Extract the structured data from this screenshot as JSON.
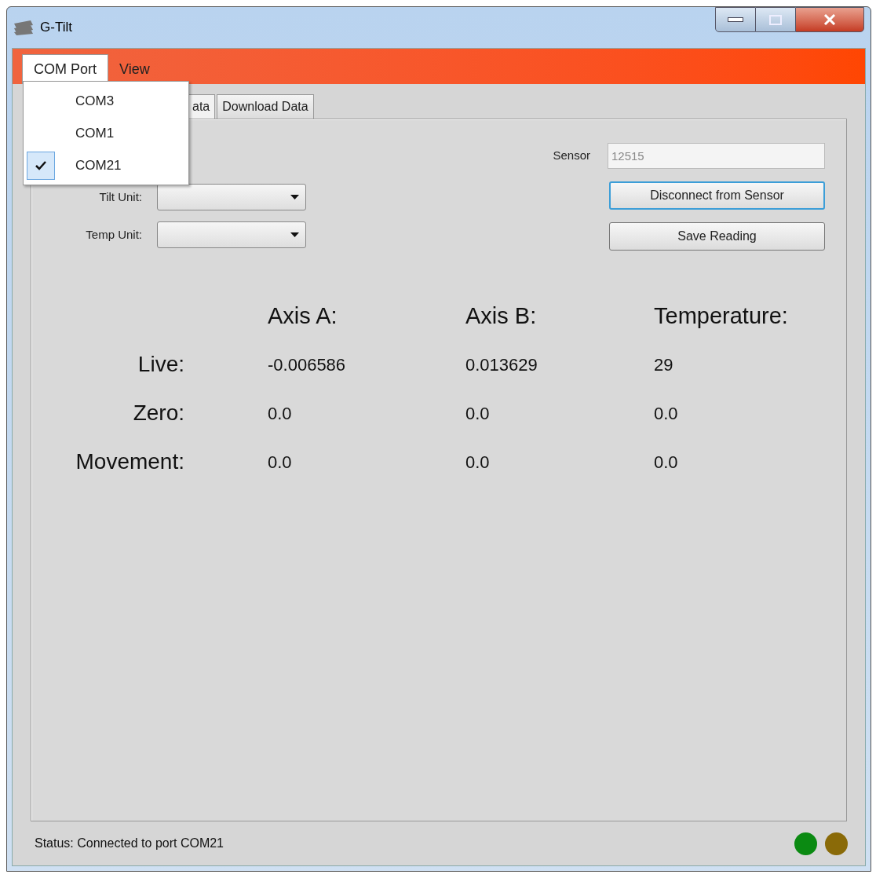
{
  "window": {
    "title": "G-Tilt"
  },
  "menu_bar": [
    {
      "label": "COM Port",
      "selected": true
    },
    {
      "label": "View",
      "selected": false
    }
  ],
  "com_port_menu": [
    {
      "label": "COM3",
      "checked": false
    },
    {
      "label": "COM1",
      "checked": false
    },
    {
      "label": "COM21",
      "checked": true
    }
  ],
  "tabs": [
    {
      "label": "ata",
      "selected": true
    },
    {
      "label": "Download Data",
      "selected": false
    }
  ],
  "settings": [
    {
      "label": "Tilt Unit:"
    },
    {
      "label": "Temp Unit:"
    }
  ],
  "sensor": {
    "label": "Sensor",
    "value": "12515"
  },
  "buttons": [
    {
      "label": "Disconnect from Sensor",
      "focused": true
    },
    {
      "label": "Save Reading",
      "focused": false
    }
  ],
  "readings": {
    "columns": [
      "Axis A:",
      "Axis B:",
      "Temperature:"
    ],
    "rows": [
      {
        "label": "Live:",
        "values": [
          "-0.006586",
          "0.013629",
          "29"
        ]
      },
      {
        "label": "Zero:",
        "values": [
          "0.0",
          "0.0",
          "0.0"
        ]
      },
      {
        "label": "Movement:",
        "values": [
          "0.0",
          "0.0",
          "0.0"
        ]
      }
    ]
  },
  "status_bar": {
    "text": "Status: Connected to port COM21",
    "lights": [
      {
        "color": "#0b8a12"
      },
      {
        "color": "#8a6a08"
      }
    ]
  }
}
